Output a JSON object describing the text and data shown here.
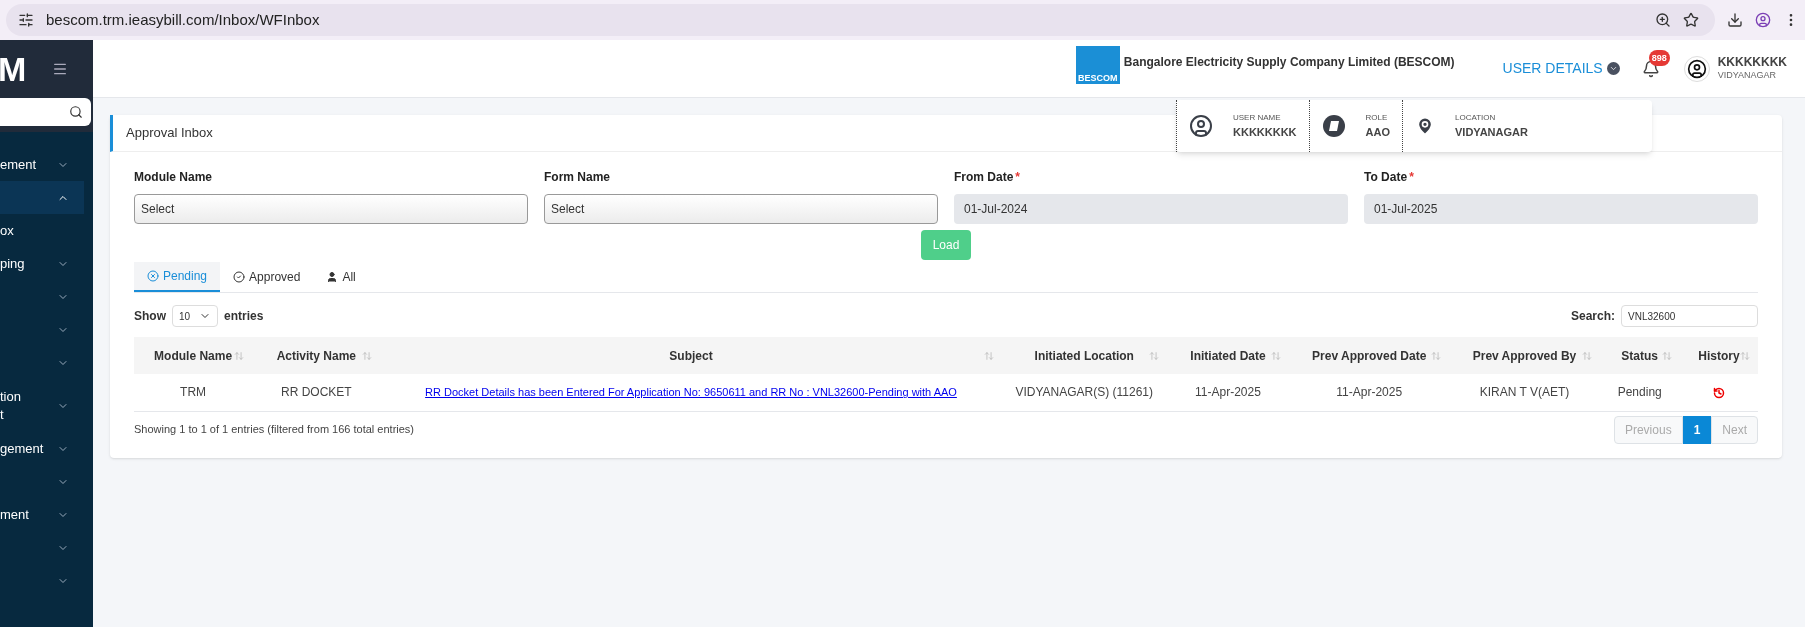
{
  "browser": {
    "url": "bescom.trm.ieasybill.com/Inbox/WFInbox"
  },
  "sidebar": {
    "logo": "M",
    "items": [
      {
        "kind": "group",
        "label": "ement",
        "expanded": false,
        "selected": false
      },
      {
        "kind": "group",
        "expanded": true,
        "selected": true
      },
      {
        "kind": "link",
        "label": "ox",
        "selected": false
      },
      {
        "kind": "group",
        "label": "ping",
        "expanded": false,
        "selected": false
      },
      {
        "kind": "group",
        "expanded": false,
        "selected": false
      },
      {
        "kind": "group",
        "expanded": false,
        "selected": false
      },
      {
        "kind": "group",
        "expanded": false,
        "selected": false
      },
      {
        "kind": "group",
        "label": "tion",
        "label2": "t",
        "expanded": false,
        "selected": false
      },
      {
        "kind": "group",
        "label": "gement",
        "expanded": false,
        "selected": false
      },
      {
        "kind": "group",
        "expanded": false,
        "selected": false
      },
      {
        "kind": "group",
        "label": "ment",
        "expanded": false,
        "selected": false
      },
      {
        "kind": "group",
        "expanded": false,
        "selected": false
      },
      {
        "kind": "group",
        "expanded": false,
        "selected": false
      }
    ]
  },
  "header": {
    "company": "Bangalore Electricity Supply Company Limited (BESCOM)",
    "logo_caption": "BESCOM",
    "user_details": "USER DETAILS",
    "notifications": "898",
    "user_name": "KKKKKKKK",
    "user_location": "VIDYANAGAR"
  },
  "user_popup": [
    {
      "kind": "user",
      "label": "USER NAME",
      "value": "KKKKKKKK"
    },
    {
      "kind": "role",
      "label": "ROLE",
      "value": "AAO"
    },
    {
      "kind": "location",
      "label": "LOCATION",
      "value": "VIDYANAGAR"
    }
  ],
  "card": {
    "title": "Approval Inbox",
    "filters": [
      {
        "label": "Module Name",
        "kind": "select",
        "value": "Select"
      },
      {
        "label": "Form Name",
        "kind": "select",
        "value": "Select"
      },
      {
        "label": "From Date",
        "required_mark": "*",
        "kind": "date",
        "value": "01-Jul-2024"
      },
      {
        "label": "To Date",
        "required_mark": "*",
        "kind": "date",
        "value": "01-Jul-2025"
      }
    ],
    "load_button": "Load",
    "tabs": [
      {
        "label": "Pending",
        "kind": "pending",
        "selected": true
      },
      {
        "label": "Approved",
        "kind": "approved",
        "selected": false
      },
      {
        "label": "All",
        "kind": "all",
        "selected": false
      }
    ],
    "show_label": "Show",
    "page_size": "10",
    "entries_label": "entries",
    "search_label": "Search:",
    "search_value": "VNL32600",
    "table": {
      "columns": [
        "Module Name",
        "Activity Name",
        "Subject",
        "Initiated Location",
        "Initiated Date",
        "Prev Approved Date",
        "Prev Approved By",
        "Status",
        "History"
      ],
      "rows": [
        {
          "cells": [
            "TRM",
            "RR DOCKET",
            "RR Docket Details has been Entered For Application No: 9650611 and RR No : VNL32600-Pending with AAO",
            "VIDYANAGAR(S) (11261)",
            "11-Apr-2025",
            "11-Apr-2025",
            "KIRAN T V(AET)",
            "Pending"
          ]
        }
      ]
    },
    "info": "Showing 1 to 1 of 1 entries (filtered from 166 total entries)",
    "pagination": [
      {
        "label": "Previous",
        "disabled": true,
        "selected": false
      },
      {
        "label": "1",
        "disabled": false,
        "selected": true
      },
      {
        "label": "Next",
        "disabled": true,
        "selected": false
      }
    ]
  }
}
